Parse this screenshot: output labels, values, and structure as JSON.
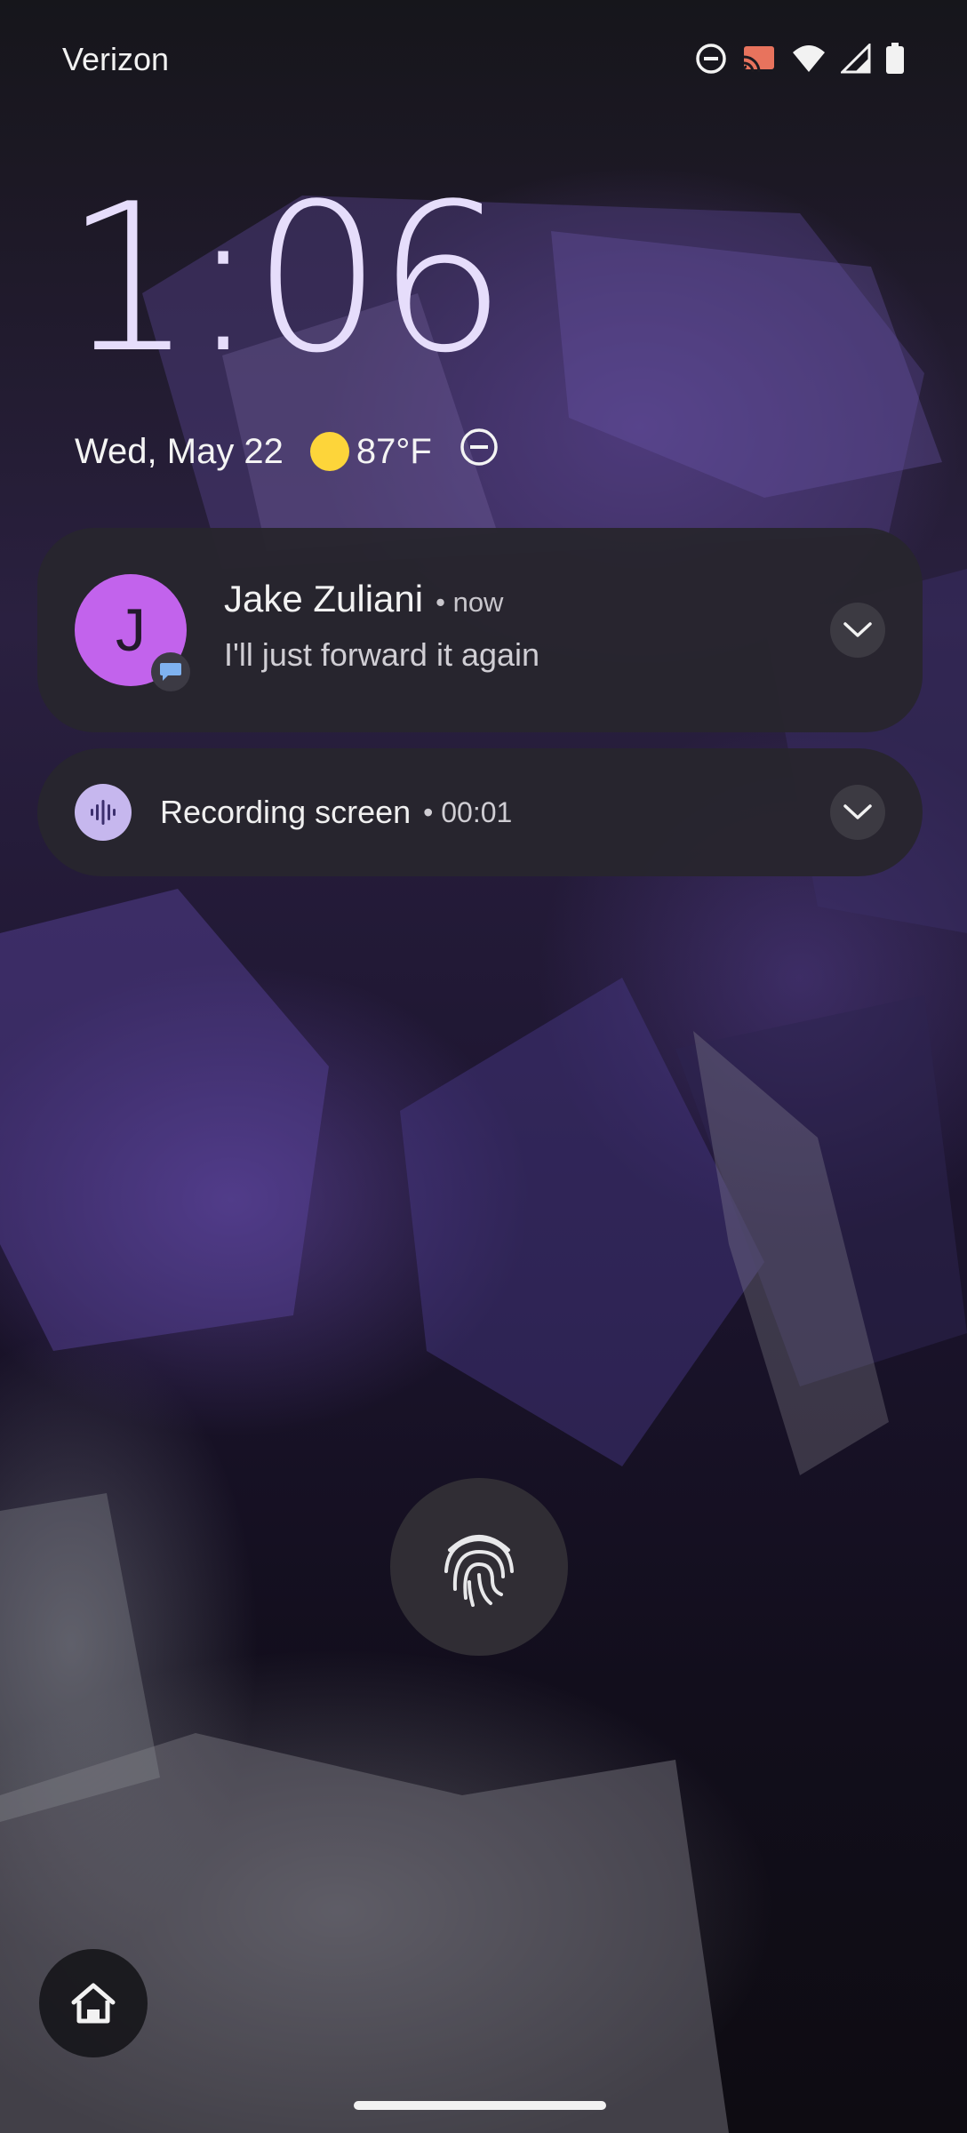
{
  "status_bar": {
    "carrier": "Verizon",
    "icons": [
      "do-not-disturb-icon",
      "cast-icon",
      "wifi-icon",
      "cell-signal-icon",
      "battery-icon"
    ],
    "cast_color": "#e8735d"
  },
  "lockscreen": {
    "time": "1:06",
    "date": "Wed, May 22",
    "weather_temp": "87°F",
    "weather_icon": "sun-icon",
    "dnd_icon": "do-not-disturb-icon"
  },
  "notifications": [
    {
      "sender": "Jake Zuliani",
      "time": "• now",
      "message": "I'll just forward it again",
      "avatar_letter": "J",
      "avatar_color": "#c263ec",
      "app_badge": "messages-icon"
    },
    {
      "title": "Recording screen",
      "meta": "• 00:01",
      "icon": "sound-wave-icon",
      "icon_bg": "#c6b7ee"
    }
  ],
  "controls": {
    "fingerprint_icon": "fingerprint-icon",
    "home_icon": "home-icon"
  }
}
